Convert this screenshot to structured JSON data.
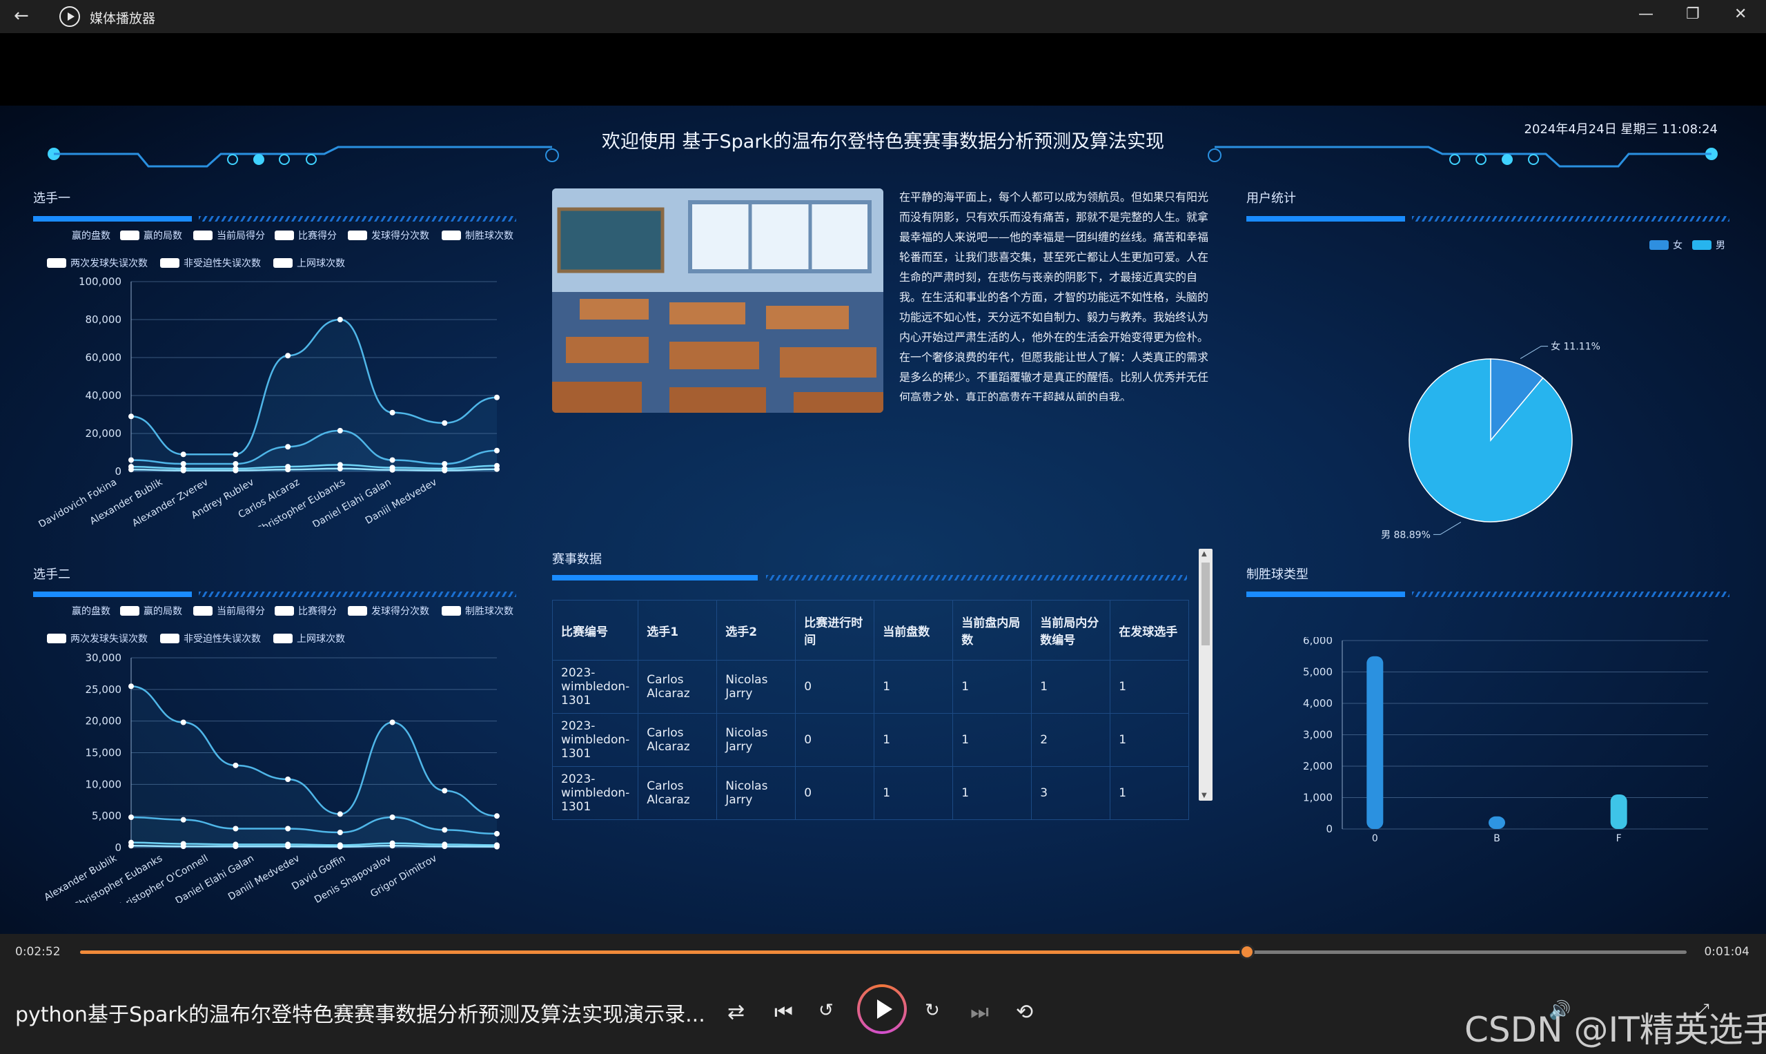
{
  "window": {
    "title": "媒体播放器",
    "back_icon": "arrow-left",
    "min": "—",
    "restore": "❐",
    "close": "✕"
  },
  "dashboard": {
    "title": "欢迎使用 基于Spark的温布尔登特色赛赛事数据分析预测及算法实现",
    "datetime": "2024年4月24日 星期三 11:08:24",
    "sections": {
      "player1": "选手一",
      "player2": "选手二",
      "user_stats": "用户统计",
      "match_data": "赛事数据",
      "win_type": "制胜球类型"
    },
    "legend": [
      "赢的盘数",
      "赢的局数",
      "当前局得分",
      "比赛得分",
      "发球得分次数",
      "制胜球次数",
      "两次发球失误次数",
      "非受迫性失误次数",
      "上网球次数"
    ],
    "description": "在平静的海平面上，每个人都可以成为领航员。但如果只有阳光而没有阴影，只有欢乐而没有痛苦，那就不是完整的人生。就拿最幸福的人来说吧——他的幸福是一团纠缠的丝线。痛苦和幸福轮番而至，让我们悲喜交集，甚至死亡都让人生更加可爱。人在生命的严肃时刻，在悲伤与丧亲的阴影下，才最接近真实的自我。在生活和事业的各个方面，才智的功能远不如性格，头脑的功能远不如心性，天分远不如自制力、毅力与教养。我始终认为内心开始过严肃生活的人，他外在的生活会开始变得更为俭朴。在一个奢侈浪费的年代，但愿我能让世人了解：人类真正的需求是多么的稀少。不重蹈覆辙才是真正的醒悟。比别人优秀并无任何高贵之处，真正的高贵在于超越从前的自我。"
  },
  "chart_data": [
    {
      "type": "line",
      "title": "选手一",
      "categories": [
        "Davidovich Fokina",
        "Alexander Bublik",
        "Alexander Zverev",
        "Andrey Rublev",
        "Carlos Alcaraz",
        "Christopher Eubanks",
        "Daniel Elahi Galan",
        "Daniil Medvedev"
      ],
      "x": [
        0,
        0.9,
        1.9,
        2.8,
        3.8,
        4.7,
        5.6,
        6.5,
        7.1
      ],
      "ylim": [
        0,
        100000
      ],
      "yticks": [
        0,
        20000,
        40000,
        60000,
        80000,
        100000
      ],
      "ytick_labels": [
        "0",
        "20,000",
        "40,000",
        "60,000",
        "80,000",
        "100,000"
      ],
      "series": [
        {
          "values": [
            29000,
            9000,
            9000,
            61000,
            80000,
            31000,
            25500,
            39000
          ]
        },
        {
          "values": [
            6000,
            4000,
            4000,
            13000,
            21500,
            6000,
            4000,
            11000
          ]
        },
        {
          "values": [
            2500,
            1500,
            1500,
            2500,
            3500,
            2000,
            1500,
            3000
          ]
        },
        {
          "values": [
            1000,
            500,
            500,
            1000,
            1500,
            800,
            500,
            1200
          ]
        }
      ]
    },
    {
      "type": "line",
      "title": "选手二",
      "categories": [
        "Alexander Bublik",
        "Christopher Eubanks",
        "Christopher O'Connell",
        "Daniel Elahi Galan",
        "Daniil Medvedev",
        "David Goffin",
        "Denis Shapovalov",
        "Grigor Dimitrov"
      ],
      "x": [
        0,
        0.9,
        1.9,
        2.8,
        3.8,
        4.7,
        5.6,
        6.5,
        7.1
      ],
      "ylim": [
        0,
        30000
      ],
      "yticks": [
        0,
        5000,
        10000,
        15000,
        20000,
        25000,
        30000
      ],
      "ytick_labels": [
        "0",
        "5,000",
        "10,000",
        "15,000",
        "20,000",
        "25,000",
        "30,000"
      ],
      "series": [
        {
          "values": [
            25500,
            19800,
            13000,
            10800,
            5300,
            19800,
            9000,
            5000
          ]
        },
        {
          "values": [
            4800,
            4400,
            3000,
            3000,
            2400,
            4800,
            2800,
            2200
          ]
        },
        {
          "values": [
            800,
            600,
            500,
            500,
            400,
            700,
            500,
            400
          ]
        },
        {
          "values": [
            300,
            200,
            200,
            200,
            150,
            300,
            200,
            150
          ]
        }
      ]
    },
    {
      "type": "pie",
      "title": "用户统计",
      "legend": [
        "女",
        "男"
      ],
      "slices": [
        {
          "name": "女",
          "value": 11.11,
          "label": "女 11.11%",
          "color": "#2e8fe0"
        },
        {
          "name": "男",
          "value": 88.89,
          "label": "男 88.89%",
          "color": "#27b4ee"
        }
      ]
    },
    {
      "type": "bar",
      "title": "制胜球类型",
      "categories": [
        "0",
        "B",
        "F"
      ],
      "values": [
        5500,
        400,
        1100
      ],
      "colors": [
        "#2b91e0",
        "#2e95e2",
        "#3ec4e8"
      ],
      "ylim": [
        0,
        6000
      ],
      "yticks": [
        0,
        1000,
        2000,
        3000,
        4000,
        5000,
        6000
      ],
      "ytick_labels": [
        "0",
        "1,000",
        "2,000",
        "3,000",
        "4,000",
        "5,000",
        "6,000"
      ]
    }
  ],
  "table": {
    "headers": [
      "比赛编号",
      "选手1",
      "选手2",
      "比赛进行时间",
      "当前盘数",
      "当前盘内局数",
      "当前局内分数编号",
      "在发球选手"
    ],
    "rows": [
      [
        "2023-wimbledon-1301",
        "Carlos Alcaraz",
        "Nicolas Jarry",
        "0",
        "1",
        "1",
        "1",
        "1"
      ],
      [
        "2023-wimbledon-1301",
        "Carlos Alcaraz",
        "Nicolas Jarry",
        "0",
        "1",
        "1",
        "2",
        "1"
      ],
      [
        "2023-wimbledon-1301",
        "Carlos Alcaraz",
        "Nicolas Jarry",
        "0",
        "1",
        "1",
        "3",
        "1"
      ]
    ]
  },
  "player": {
    "current_time": "0:02:52",
    "total_time": "0:01:04",
    "progress": 0.7265,
    "media_title": "python基于Spark的温布尔登特色赛赛事数据分析预测及算法实现演示录...",
    "accent": "#f08a3a"
  },
  "watermark": "CSDN @IT精英选手"
}
